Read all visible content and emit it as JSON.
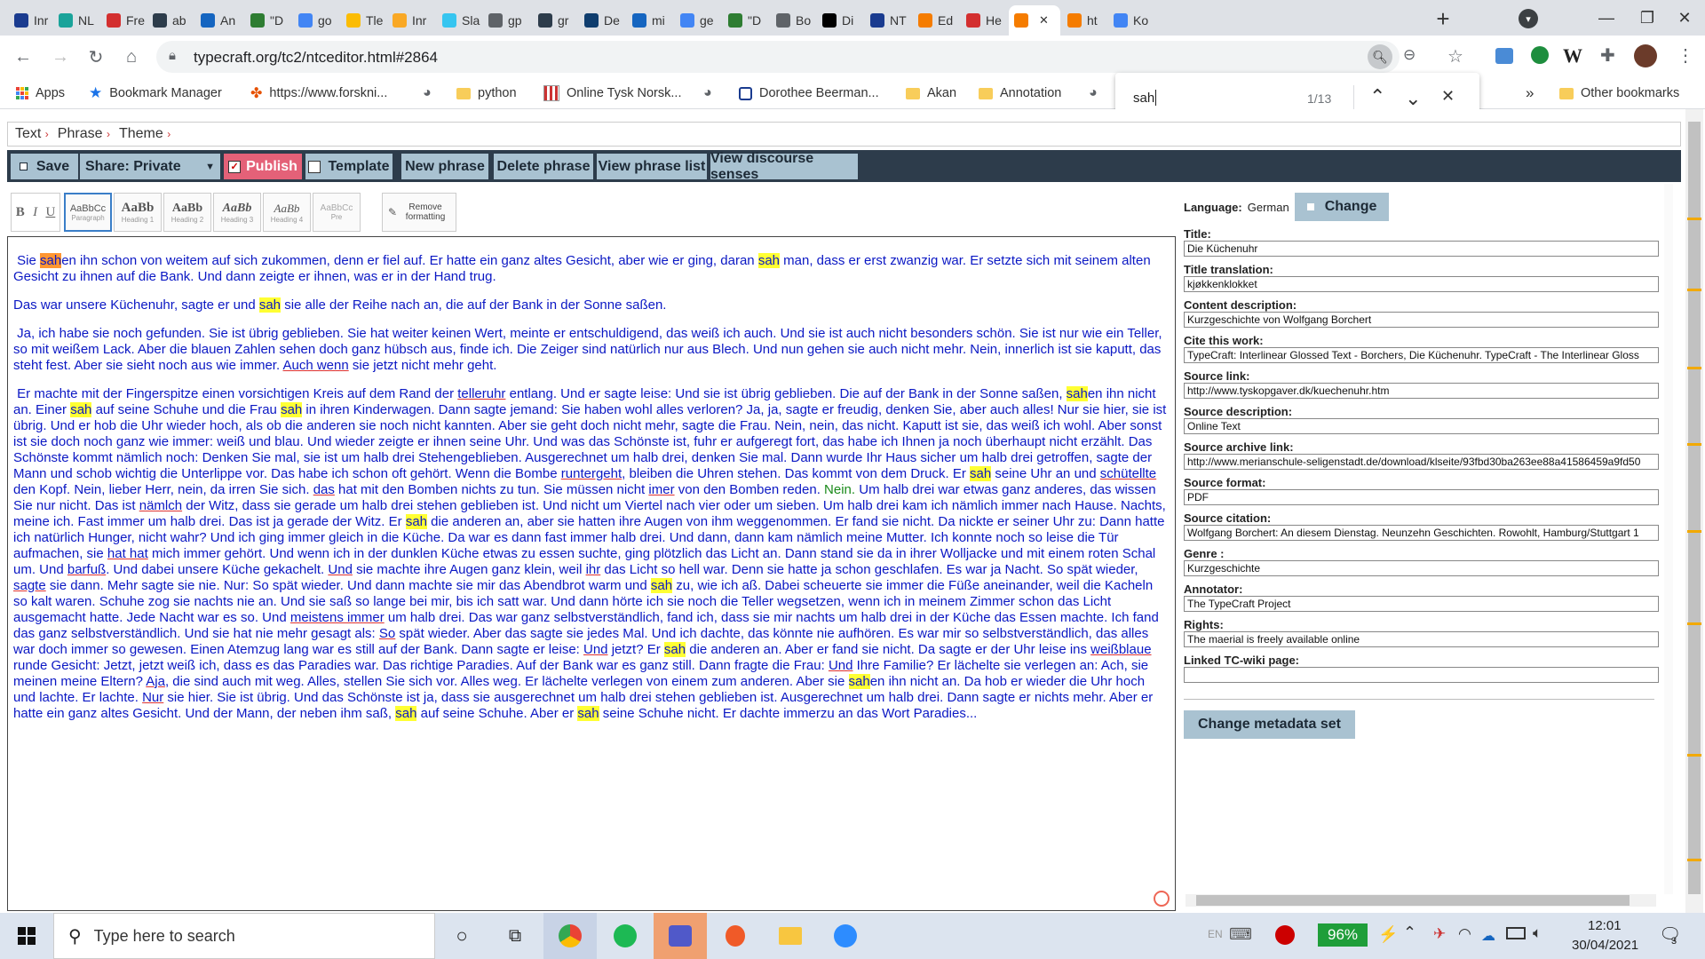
{
  "tabs": [
    {
      "title": "Inr",
      "color": "#1a3b8f"
    },
    {
      "title": "NL",
      "color": "#1aa39a"
    },
    {
      "title": "Fre",
      "color": "#d32f2f"
    },
    {
      "title": "ab",
      "color": "#2d3c4b"
    },
    {
      "title": "An",
      "color": "#1565c0"
    },
    {
      "title": "\"D",
      "color": "#2e7d32"
    },
    {
      "title": "go",
      "color": "#4285f4"
    },
    {
      "title": "Tle",
      "color": "#fbbc04"
    },
    {
      "title": "Inr",
      "color": "#f9a825"
    },
    {
      "title": "Sla",
      "color": "#36c5f0"
    },
    {
      "title": "gp",
      "color": "#5f6368"
    },
    {
      "title": "gr",
      "color": "#2d3c4b"
    },
    {
      "title": "De",
      "color": "#0f3d6e"
    },
    {
      "title": "mi",
      "color": "#1565c0"
    },
    {
      "title": "ge",
      "color": "#4285f4"
    },
    {
      "title": "\"D",
      "color": "#2e7d32"
    },
    {
      "title": "Bo",
      "color": "#5f6368"
    },
    {
      "title": "Di",
      "color": "#000000"
    },
    {
      "title": "NT",
      "color": "#1a3b8f"
    },
    {
      "title": "Ed",
      "color": "#f57c00"
    },
    {
      "title": "He",
      "color": "#d32f2f"
    },
    {
      "title": "",
      "color": "#f57c00"
    },
    {
      "title": "ht",
      "color": "#f57c00"
    },
    {
      "title": "Ko",
      "color": "#4285f4"
    }
  ],
  "address": {
    "url": "typecraft.org/tc2/ntceditor.html#2864"
  },
  "bookmarks": {
    "apps": "Apps",
    "manager": "Bookmark Manager",
    "forskning": "https://www.forskni...",
    "python": "python",
    "tysk": "Online Tysk Norsk...",
    "beerman": "Dorothee Beerman...",
    "akan": "Akan",
    "annotation": "Annotation",
    "more": "»",
    "other": "Other bookmarks"
  },
  "find": {
    "query": "sah",
    "count": "1/13"
  },
  "breadcrumb": {
    "text": "Text",
    "phrase": "Phrase",
    "theme": "Theme",
    "sep": "›"
  },
  "toolbar": {
    "save": "Save",
    "share": "Share: Private",
    "publish": "Publish",
    "template": "Template",
    "new_phrase": "New phrase",
    "delete_phrase": "Delete phrase",
    "view_list": "View phrase list",
    "view_senses": "View discourse senses"
  },
  "format": {
    "bold": "B",
    "italic": "I",
    "underline": "U",
    "paragraph": {
      "big": "AaBbCc",
      "small": "Paragraph"
    },
    "h1": {
      "big": "AaBb",
      "small": "Heading 1"
    },
    "h2": {
      "big": "AaBb",
      "small": "Heading 2"
    },
    "h3": {
      "big": "AaBb",
      "small": "Heading 3"
    },
    "h4": {
      "big": "AaBb",
      "small": "Heading 4"
    },
    "pre": {
      "big": "AaBbCc",
      "small": "Pre"
    },
    "remove": "Remove formatting"
  },
  "metadata": {
    "language_label": "Language:",
    "language": "German",
    "change": "Change",
    "fields": [
      {
        "label": "Title:",
        "value": "Die Küchenuhr"
      },
      {
        "label": "Title translation:",
        "value": "kjøkkenklokket"
      },
      {
        "label": "Content description:",
        "value": "Kurzgeschichte von Wolfgang Borchert"
      },
      {
        "label": "Cite this work:",
        "value": "TypeCraft: Interlinear Glossed Text - Borchers, Die Küchenuhr. TypeCraft - The Interlinear Gloss"
      },
      {
        "label": "Source link:",
        "value": "http://www.tyskopgaver.dk/kuechenuhr.htm"
      },
      {
        "label": "Source description:",
        "value": "Online Text"
      },
      {
        "label": "Source archive link:",
        "value": "http://www.merianschule-seligenstadt.de/download/klseite/93fbd30ba263ee88a41586459a9fd50"
      },
      {
        "label": "Source format:",
        "value": "PDF"
      },
      {
        "label": "Source citation:",
        "value": "Wolfgang Borchert: An diesem Dienstag. Neunzehn Geschichten. Rowohlt, Hamburg/Stuttgart 1"
      },
      {
        "label": "Genre :",
        "value": "Kurzgeschichte"
      },
      {
        "label": "Annotator:",
        "value": "The TypeCraft Project"
      },
      {
        "label": "Rights:",
        "value": "The maerial is freely available online"
      },
      {
        "label": "Linked TC-wiki page:",
        "value": ""
      }
    ],
    "change_set": "Change metadata set"
  },
  "taskbar": {
    "search": "Type here to search",
    "battery": "96%",
    "time": "12:01",
    "date": "30/04/2021",
    "lang": "EN",
    "notif": "3"
  }
}
